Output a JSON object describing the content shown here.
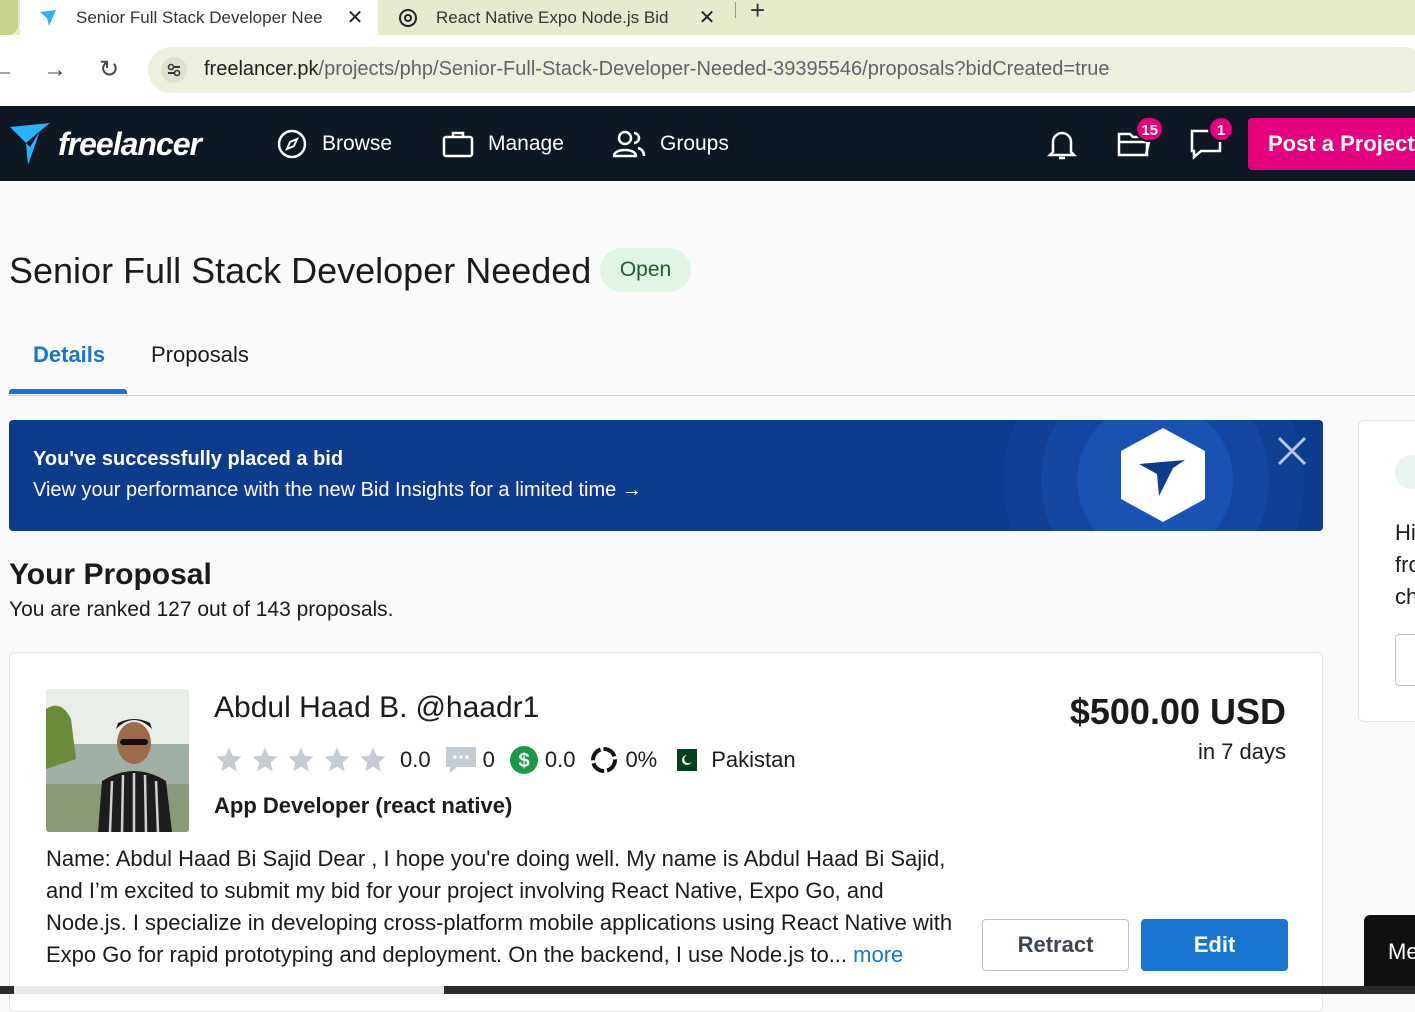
{
  "browser": {
    "tabs": [
      {
        "title": "Senior Full Stack Developer Nee",
        "active": true,
        "favicon": "freelancer-icon"
      },
      {
        "title": "React Native Expo Node.js Bid",
        "active": false,
        "favicon": "chatgpt-icon"
      }
    ],
    "new_tab_label": "+",
    "close_glyph": "✕",
    "url_host": "freelancer.pk",
    "url_path": "/projects/php/Senior-Full-Stack-Developer-Needed-39395546/proposals?bidCreated=true"
  },
  "header": {
    "logo_text": "freelancer",
    "nav": [
      {
        "label": "Browse",
        "icon": "compass-icon"
      },
      {
        "label": "Manage",
        "icon": "briefcase-icon"
      },
      {
        "label": "Groups",
        "icon": "users-icon"
      }
    ],
    "notifications_icon": "bell-icon",
    "projects_badge": "15",
    "messages_badge": "1",
    "post_project_label": "Post a Project",
    "colors": {
      "bg": "#0e1724",
      "accent": "#e6007e"
    }
  },
  "project": {
    "title": "Senior Full Stack Developer Needed",
    "status": "Open"
  },
  "tabs": {
    "details": "Details",
    "proposals": "Proposals"
  },
  "banner": {
    "headline": "You've successfully placed a bid",
    "subtext": "View your performance with the new Bid Insights for a limited time →"
  },
  "side_panel": {
    "text": "Hi\nfro\nch"
  },
  "your_proposal": {
    "title": "Your Proposal",
    "rank_text": "You are ranked 127 out of 143 proposals."
  },
  "proposal": {
    "name": "Abdul Haad B.",
    "handle": "@haadr1",
    "rating": "0.0",
    "reviews": "0",
    "earnings_score": "0.0",
    "completion": "0%",
    "country": "Pakistan",
    "tagline": "App Developer (react native)",
    "price": "$500.00 USD",
    "delivery": "in 7 days",
    "description": "Name: Abdul Haad Bi Sajid Dear , I hope you're doing well. My name is Abdul Haad Bi Sajid, and I’m excited to submit my bid for your project involving React Native, Expo Go, and Node.js. I specialize in developing cross-platform mobile applications using React Native with Expo Go for rapid prototyping and deployment. On the backend, I use Node.js to...",
    "more_label": "more",
    "retract_label": "Retract",
    "edit_label": "Edit"
  },
  "bottom_widget": {
    "label": "Me"
  }
}
